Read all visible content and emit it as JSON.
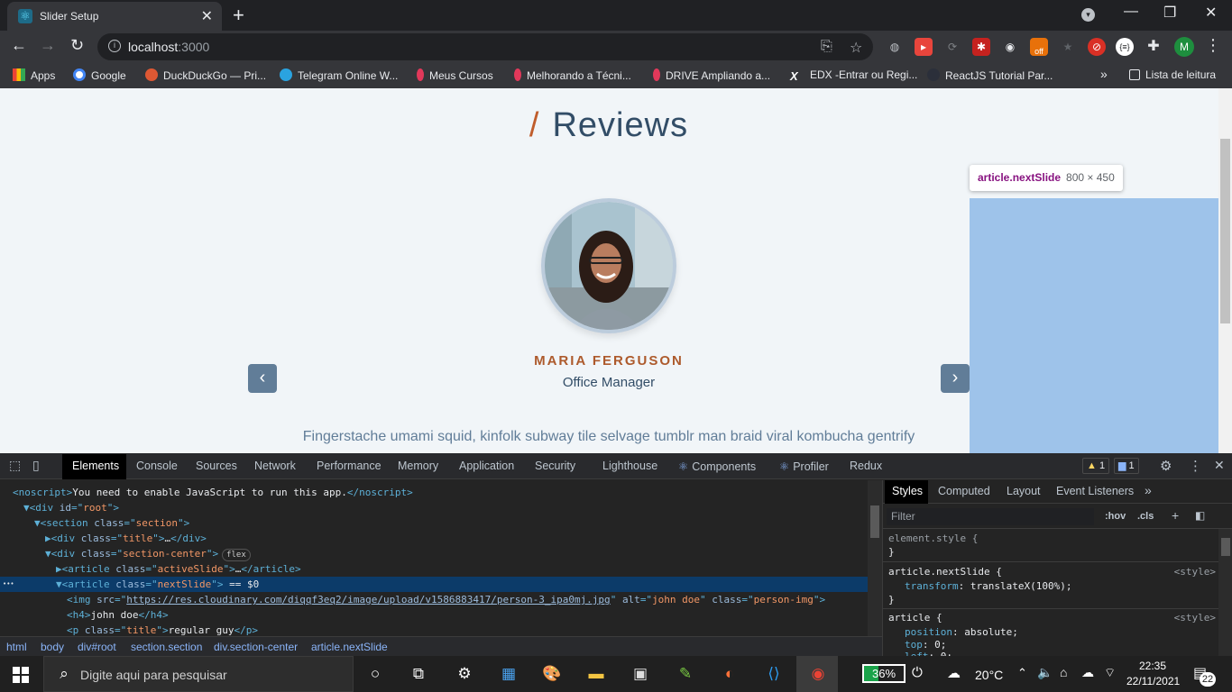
{
  "browser": {
    "tab_title": "Slider Setup",
    "url_host": "localhost",
    "url_port": ":3000",
    "profile_initial": "M",
    "extension_badge": "off",
    "bookmarks": [
      {
        "label": "Apps",
        "icon": "apps-grid-icon",
        "color": "#ea4335"
      },
      {
        "label": "Google",
        "icon": "google-icon",
        "color": "#4285f4"
      },
      {
        "label": "DuckDuckGo — Pri...",
        "icon": "duckduckgo-icon",
        "color": "#de5833"
      },
      {
        "label": "Telegram Online W...",
        "icon": "telegram-icon",
        "color": "#2aa3e0"
      },
      {
        "label": "Meus Cursos",
        "icon": "music-note-icon",
        "color": "#e2385a"
      },
      {
        "label": "Melhorando a Técni...",
        "icon": "music-note-icon",
        "color": "#e2385a"
      },
      {
        "label": "DRIVE Ampliando a...",
        "icon": "music-note-icon",
        "color": "#e2385a"
      },
      {
        "label": "EDX -Entrar ou Regi...",
        "icon": "edx-icon",
        "color": "#ffffff"
      },
      {
        "label": "ReactJS Tutorial Par...",
        "icon": "react-icon",
        "color": "#2b2b2b"
      }
    ],
    "reading_list": "Lista de leitura"
  },
  "page": {
    "heading_slash": "/",
    "heading": "Reviews",
    "person_name": "MARIA FERGUSON",
    "person_title": "Office Manager",
    "quote": "Fingerstache umami squid, kinfolk subway tile selvage tumblr man braid viral kombucha gentrify",
    "prev_icon": "‹",
    "next_icon": "›",
    "tooltip_tag": "article",
    "tooltip_class": ".nextSlide",
    "tooltip_dims": "800 × 450"
  },
  "devtools": {
    "tabs": [
      "Elements",
      "Console",
      "Sources",
      "Network",
      "Performance",
      "Memory",
      "Application",
      "Security",
      "Lighthouse",
      "Components",
      "Profiler",
      "Redux"
    ],
    "warnings": "1",
    "messages": "1",
    "dom_lines": [
      {
        "indent": 0,
        "html": "<span class='tg'>&lt;noscript&gt;</span><span class='tx'>You need to enable JavaScript to run this app.</span><span class='tg'>&lt;/noscript&gt;</span>"
      },
      {
        "indent": 1,
        "html": "<span class='tg'>▼&lt;div </span><span class='at'>id</span><span class='tg'>=\"</span><span class='av'>root</span><span class='tg'>\"&gt;</span>"
      },
      {
        "indent": 2,
        "html": "<span class='tg'>▼&lt;section </span><span class='at'>class</span><span class='tg'>=\"</span><span class='av'>section</span><span class='tg'>\"&gt;</span>"
      },
      {
        "indent": 3,
        "html": "<span class='tg'>▶&lt;div </span><span class='at'>class</span><span class='tg'>=\"</span><span class='av'>title</span><span class='tg'>\"&gt;</span><span class='tx'>…</span><span class='tg'>&lt;/div&gt;</span>"
      },
      {
        "indent": 3,
        "html": "<span class='tg'>▼&lt;div </span><span class='at'>class</span><span class='tg'>=\"</span><span class='av'>section-center</span><span class='tg'>\"&gt;</span><span class='flexbadge'>flex</span>"
      },
      {
        "indent": 4,
        "html": "<span class='tg'>▶&lt;article </span><span class='at'>class</span><span class='tg'>=\"</span><span class='av'>activeSlide</span><span class='tg'>\"&gt;</span><span class='tx'>…</span><span class='tg'>&lt;/article&gt;</span>"
      },
      {
        "indent": 4,
        "html": "<span class='tg'>▼&lt;article </span><span class='at'>class</span><span class='tg'>=\"</span><span class='av'>nextSlide</span><span class='tg'>\"&gt;</span><span class='tx'> == $0</span>",
        "selected": true
      },
      {
        "indent": 5,
        "html": "<span class='tg'>&lt;img </span><span class='at'>src</span><span class='tg'>=\"</span><span class='lk'>https://res.cloudinary.com/diqqf3eq2/image/upload/v1586883417/person-3_ipa0mj.jpg</span><span class='tg'>\" </span><span class='at'>alt</span><span class='tg'>=\"</span><span class='av'>john doe</span><span class='tg'>\" </span><span class='at'>class</span><span class='tg'>=\"</span><span class='av'>person-img</span><span class='tg'>\"&gt;</span>"
      },
      {
        "indent": 5,
        "html": "<span class='tg'>&lt;h4&gt;</span><span class='tx'>john doe</span><span class='tg'>&lt;/h4&gt;</span>"
      },
      {
        "indent": 5,
        "html": "<span class='tg'>&lt;p </span><span class='at'>class</span><span class='tg'>=\"</span><span class='av'>title</span><span class='tg'>\"&gt;</span><span class='tx'>regular guy</span><span class='tg'>&lt;/p&gt;</span>"
      }
    ],
    "breadcrumbs": [
      "html",
      "body",
      "div#root",
      "section.section",
      "div.section-center",
      "article.nextSlide"
    ],
    "styles_tabs": [
      "Styles",
      "Computed",
      "Layout",
      "Event Listeners"
    ],
    "filter_placeholder": "Filter",
    "hov": ":hov",
    "cls": ".cls",
    "rules": [
      {
        "selector": "element.style {",
        "source": ""
      },
      {
        "selector": "article.nextSlide {",
        "source": "<style>",
        "prop": "transform",
        "value": "translateX(100%);"
      },
      {
        "selector": "article {",
        "source": "<style>",
        "prop": "position",
        "value": "absolute;",
        "prop2": "top",
        "value2": "0;",
        "prop3": "left",
        "value3": "0;"
      }
    ]
  },
  "taskbar": {
    "search_placeholder": "Digite aqui para pesquisar",
    "battery": "36%",
    "temperature": "20°C",
    "time": "22:35",
    "date": "22/11/2021",
    "notifications": "22"
  }
}
